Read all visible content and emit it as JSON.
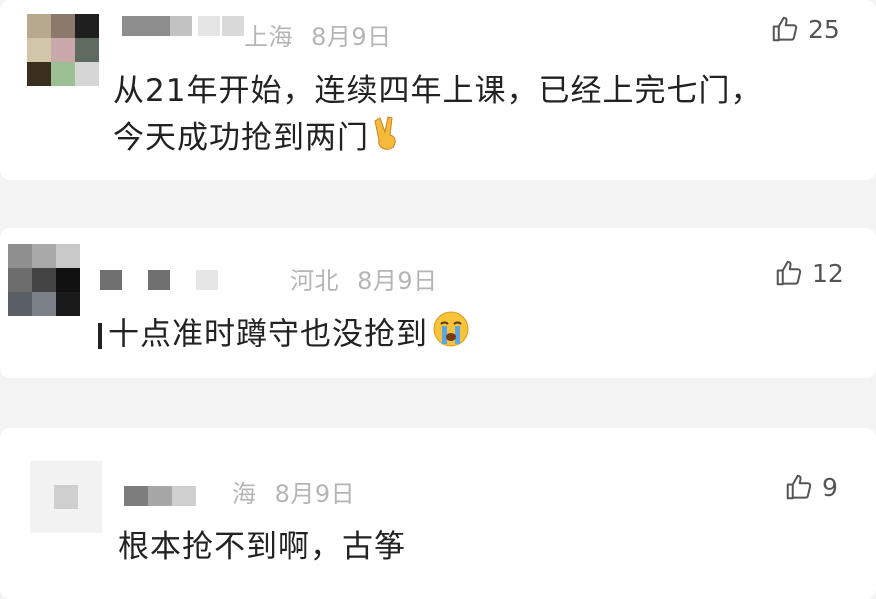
{
  "comments": [
    {
      "location": "上海",
      "location_visible": "上海",
      "date": "8月9日",
      "likes": "25",
      "text_line1": "从21年开始，连续四年上课，已经上完七门，",
      "text_line2": "今天成功抢到两门",
      "emoji": "victory-hand"
    },
    {
      "location": "河北",
      "date": "8月9日",
      "likes": "12",
      "text_line1": "十点准时蹲守也没抢到",
      "emoji": "loudly-crying-face"
    },
    {
      "location": "海",
      "date": "8月9日",
      "likes": "9",
      "text_line1": "根本抢不到啊，古筝"
    }
  ],
  "icons": {
    "like": "thumbs-up-icon"
  }
}
